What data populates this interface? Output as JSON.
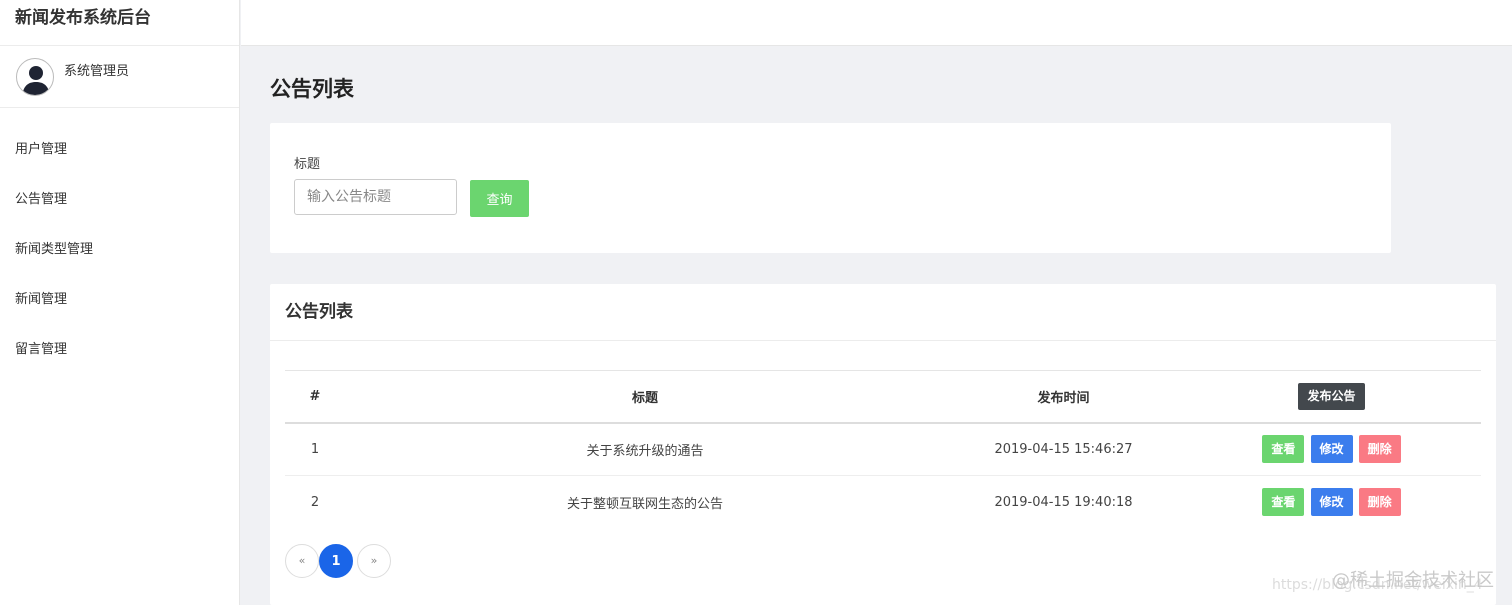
{
  "brand": {
    "title": "新闻发布系统后台"
  },
  "user": {
    "name": "系统管理员",
    "avatar_icon": "user-avatar-icon"
  },
  "sidebar": {
    "items": [
      {
        "label": "用户管理"
      },
      {
        "label": "公告管理"
      },
      {
        "label": "新闻类型管理"
      },
      {
        "label": "新闻管理"
      },
      {
        "label": "留言管理"
      }
    ]
  },
  "page": {
    "title": "公告列表"
  },
  "search": {
    "label": "标题",
    "placeholder": "输入公告标题",
    "value": "",
    "button_label": "查询",
    "button_color": "#6bd56f"
  },
  "list": {
    "header": "公告列表",
    "columns": {
      "num": "#",
      "title": "标题",
      "time": "发布时间"
    },
    "publish_label": "发布公告",
    "rows": [
      {
        "num": "1",
        "title": "关于系统升级的通告",
        "time": "2019-04-15 15:46:27"
      },
      {
        "num": "2",
        "title": "关于整顿互联网生态的公告",
        "time": "2019-04-15 19:40:18"
      }
    ],
    "actions": {
      "view": "查看",
      "edit": "修改",
      "delete": "删除"
    },
    "action_colors": {
      "view": "#6bd56f",
      "edit": "#3b7ded",
      "delete": "#fa7a84"
    }
  },
  "pagination": {
    "prev": "«",
    "current": "1",
    "next": "»",
    "active_color": "#1a65e8"
  },
  "watermark": {
    "text": "@稀土掘金技术社区",
    "url": "https://blog.csdn.net/weixin_4"
  }
}
